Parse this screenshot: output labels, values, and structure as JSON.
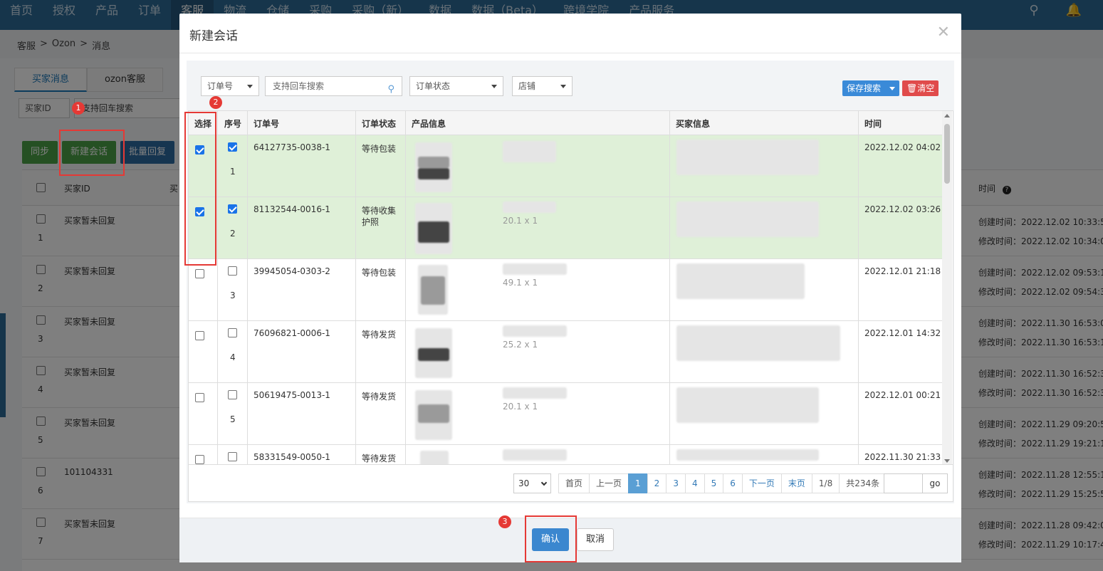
{
  "nav": {
    "items": [
      "首页",
      "授权",
      "产品",
      "订单",
      "客服",
      "物流",
      "仓储",
      "采购",
      "采购（新）",
      "数据",
      "数据（Beta）",
      "跨境学院",
      "产品服务"
    ],
    "active_index": 4,
    "search_icon": "search-icon",
    "bell_icon": "bell-icon"
  },
  "breadcrumb": {
    "items": [
      "客服",
      "Ozon",
      "消息"
    ],
    "separator": ">"
  },
  "bg": {
    "tabs": [
      "买家消息",
      "ozon客服"
    ],
    "filter_select": "买家ID",
    "filter_input_placeholder": "支持回车搜索",
    "buttons": {
      "sync": "同步",
      "new_session": "新建会话",
      "batch_reply": "批量回复"
    },
    "table_headers": {
      "buyer_id": "买家ID",
      "col2": "买",
      "time": "时间"
    },
    "rows": [
      {
        "index": "1",
        "buyer": "买家暂未回复",
        "created": "创建时间：2022.12.02 10:33:57",
        "modified": "修改时间：2022.12.02 10:34:03"
      },
      {
        "index": "2",
        "buyer": "买家暂未回复",
        "created": "创建时间：2022.12.02 09:53:13",
        "modified": "修改时间：2022.12.02 09:54:37"
      },
      {
        "index": "3",
        "buyer": "买家暂未回复",
        "created": "创建时间：2022.11.30 16:53:03",
        "modified": "修改时间：2022.11.30 16:53:13"
      },
      {
        "index": "4",
        "buyer": "买家暂未回复",
        "created": "创建时间：2022.11.30 16:52:33",
        "modified": "修改时间：2022.11.30 16:52:39"
      },
      {
        "index": "5",
        "buyer": "买家暂未回复",
        "created": "创建时间：2022.11.29 09:20:53",
        "modified": "修改时间：2022.11.29 19:21:11"
      },
      {
        "index": "6",
        "buyer": "101104331",
        "created": "创建时间：2022.11.28 12:55:19",
        "modified": "修改时间：2022.11.29 15:25:58"
      },
      {
        "index": "7",
        "buyer": "买家暂未回复",
        "created": "创建时间：2022.11.28 09:42:01",
        "modified": "修改时间：2022.11.29 10:17:49"
      }
    ]
  },
  "modal": {
    "title": "新建会话",
    "close_icon": "close-icon",
    "filters": {
      "order_no": "订单号",
      "search_placeholder": "支持回车搜索",
      "order_status": "订单状态",
      "shop": "店铺"
    },
    "save_search": "保存搜索",
    "clear": "清空",
    "headers": {
      "select": "选择",
      "index": "序号",
      "order_no": "订单号",
      "status": "订单状态",
      "product": "产品信息",
      "buyer": "买家信息",
      "time": "时间"
    },
    "rows": [
      {
        "selected": true,
        "index": "1",
        "order": "64127735-0038-1",
        "status": "等待包装",
        "status2": "",
        "qty": "",
        "time": "2022.12.02 04:02"
      },
      {
        "selected": true,
        "index": "2",
        "order": "81132544-0016-1",
        "status": "等待收集",
        "status2": "护照",
        "qty": "20.1 x 1",
        "time": "2022.12.02 03:26"
      },
      {
        "selected": false,
        "index": "3",
        "order": "39945054-0303-2",
        "status": "等待包装",
        "status2": "",
        "qty": "49.1 x 1",
        "time": "2022.12.01 21:18"
      },
      {
        "selected": false,
        "index": "4",
        "order": "76096821-0006-1",
        "status": "等待发货",
        "status2": "",
        "qty": "25.2 x 1",
        "time": "2022.12.01 14:32"
      },
      {
        "selected": false,
        "index": "5",
        "order": "50619475-0013-1",
        "status": "等待发货",
        "status2": "",
        "qty": "20.1 x 1",
        "time": "2022.12.01 00:21"
      },
      {
        "selected": false,
        "index": "",
        "order": "58331549-0050-1",
        "status": "等待发货",
        "status2": "",
        "qty": "",
        "time": "2022.11.30 21:33"
      }
    ],
    "pager": {
      "page_size": "30",
      "first": "首页",
      "prev": "上一页",
      "pages": [
        "1",
        "2",
        "3",
        "4",
        "5",
        "6"
      ],
      "current_page": 1,
      "next": "下一页",
      "last": "末页",
      "page_info": "1/8",
      "total": "共234条",
      "go": "go"
    },
    "ok": "确认",
    "cancel": "取消"
  },
  "annotations": {
    "badges": [
      "1",
      "2",
      "3"
    ],
    "highlight_color": "#e53935"
  }
}
